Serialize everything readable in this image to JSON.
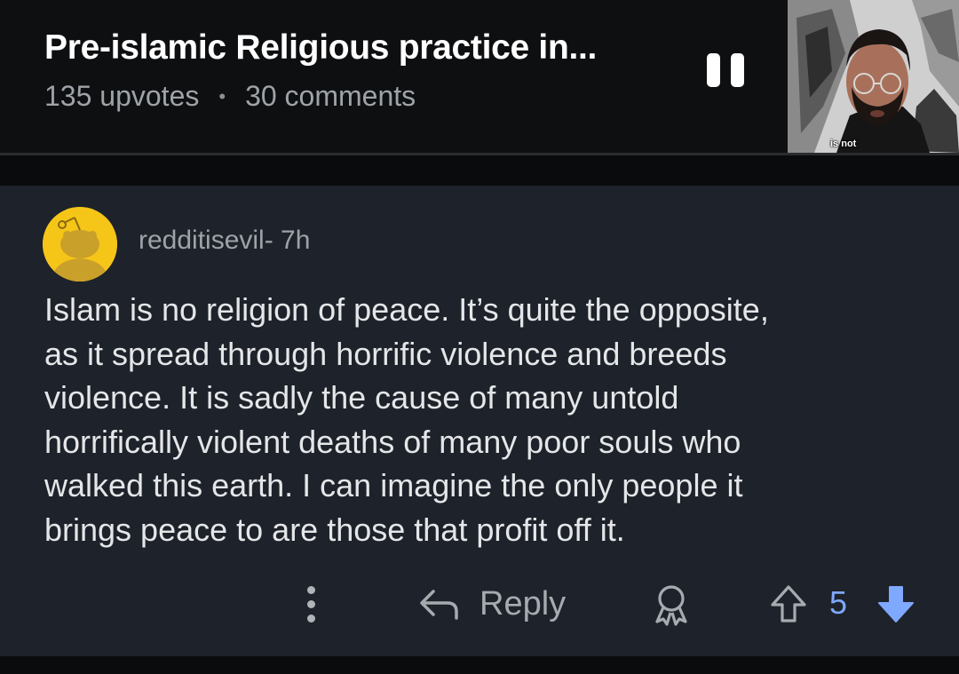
{
  "post": {
    "title": "Pre-islamic Religious practice in...",
    "upvotes": "135 upvotes",
    "separator": "•",
    "comments": "30 comments"
  },
  "video": {
    "caption": "is not"
  },
  "comment": {
    "author": "redditisevil- 7h",
    "body": "Islam is no religion of peace. It’s quite the opposite,\nas it spread through horrific violence and breeds\nviolence. It is sadly the cause of many untold\nhorrifically violent deaths of many poor souls who\nwalked this earth. I can imagine the only people it\nbrings peace to are those that profit  off it.",
    "reply_label": "Reply",
    "vote_count": "5"
  },
  "icons": {
    "pause": "pause-icon",
    "more": "more-options-icon",
    "reply": "reply-arrow-icon",
    "award": "award-icon",
    "upvote": "upvote-arrow-icon",
    "downvote": "downvote-arrow-icon"
  },
  "colors": {
    "background": "#0e0f11",
    "card": "#1e222a",
    "avatar": "#f5c518",
    "downvote_active": "#7fa8ff",
    "text_primary": "#e4e6e8",
    "text_secondary": "#9ea3a8"
  }
}
